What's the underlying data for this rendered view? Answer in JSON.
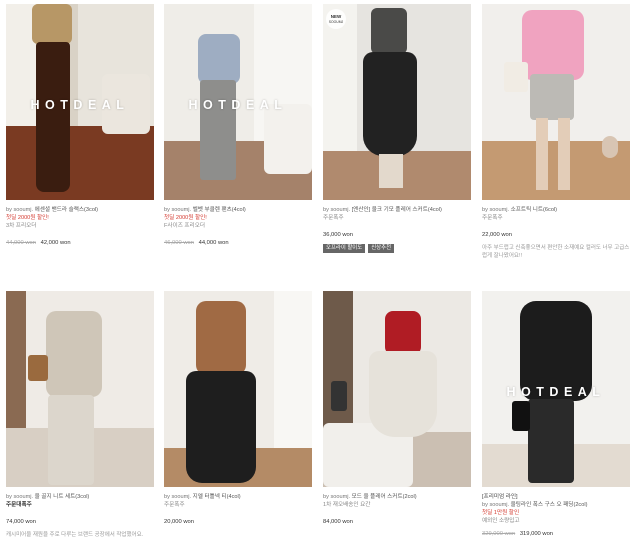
{
  "hotdeal_label": "HOTDEAL",
  "products": [
    {
      "name_prefix": "by sooumj.",
      "name": "에센셜 밴드라 슬랙스(3col)",
      "desc_red": "첫딜 2000원 할인!",
      "desc": "3차 프리오더",
      "orig_price": "44,000 won",
      "price": "42,000 won",
      "hotdeal": true
    },
    {
      "name_prefix": "by sooumj.",
      "name": "벨벳 부클렌 팬츠(4col)",
      "desc_red": "첫딜 2000원 할인!",
      "desc": "F사이즈 프리오더",
      "orig_price": "46,000 won",
      "price": "44,000 won",
      "hotdeal": true
    },
    {
      "name_prefix": "by sooumj.",
      "name": "[엔산인] 울크 기모 플레어 스커트(4col)",
      "desc": "주문폭주",
      "price": "36,000 won",
      "tags": [
        "오프라이 할이도",
        "신상추천"
      ],
      "new_badge": "NEW SOOUMJ"
    },
    {
      "name_prefix": "by sooumj.",
      "name": "소프트틱 니트(6col)",
      "desc": "주문폭주",
      "price": "22,000 won",
      "note": "아주 부드럽고 신축좋으면서 편안한 소재예요 컬러도 너무 고급스럽게 잘나왔어요!!"
    },
    {
      "name_prefix": "by sooumj.",
      "name": "울 골지 니트 세트(3col)",
      "desc_bold": "주문대폭주",
      "price": "74,000 won",
      "note": "캐시미어울 재원을 주로 다루는 브랜드 공장에서 작업했어요."
    },
    {
      "name_prefix": "by sooumj.",
      "name": "지엘 터틀넥 티(4col)",
      "desc": "주문폭주",
      "price": "20,000 won"
    },
    {
      "name_prefix": "by sooumj.",
      "name": "모드 울 플레어 스커트(2col)",
      "desc": "1차 재오배송인 요간",
      "price": "84,000 won"
    },
    {
      "name_prefix": "[프리미엄 라인]",
      "name_line2_prefix": "by sooumj.",
      "name": "울팅라인 폭스 구스 오 패딩(2col)",
      "desc_red": "첫딜 1만원 할인",
      "desc": "예외인 소량입고",
      "orig_price": "329,000 won",
      "price": "319,000 won",
      "hotdeal": true
    }
  ]
}
